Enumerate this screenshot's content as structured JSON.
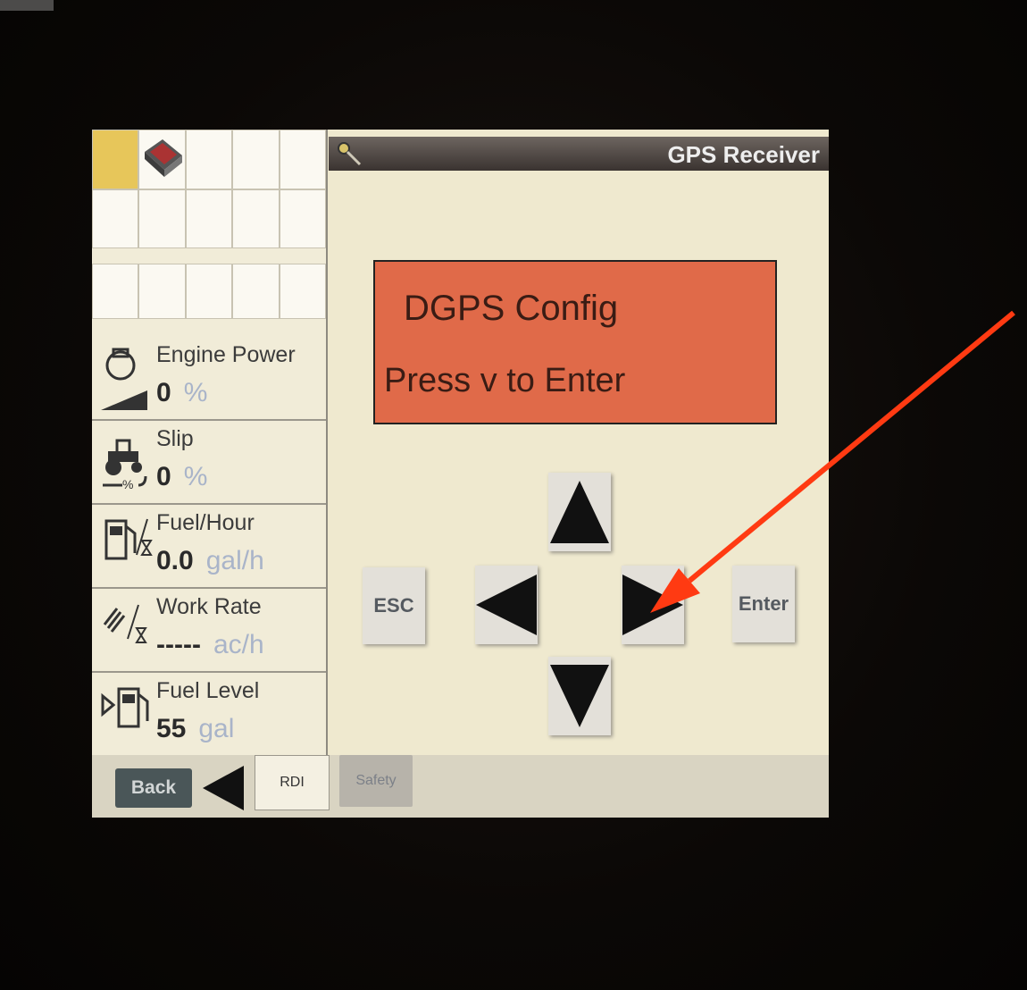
{
  "header": {
    "title": "GPS Receiver"
  },
  "display": {
    "line1": "DGPS Config",
    "line2": "Press v to Enter"
  },
  "keys": {
    "esc": "ESC",
    "enter": "Enter"
  },
  "gauges": [
    {
      "label": "Engine Power",
      "value": "0",
      "unit": "%"
    },
    {
      "label": "Slip",
      "value": "0",
      "unit": "%"
    },
    {
      "label": "Fuel/Hour",
      "value": "0.0",
      "unit": "gal/h"
    },
    {
      "label": "Work Rate",
      "value": "-----",
      "unit": "ac/h"
    },
    {
      "label": "Fuel Level",
      "value": "55",
      "unit": "gal"
    }
  ],
  "tabs": {
    "back": "Back",
    "rdi": "RDI",
    "safety": "Safety"
  },
  "colors": {
    "display_bg": "#e06a49",
    "annotation_arrow": "#ff3a12",
    "shortcut_highlight": "#e7c65a"
  }
}
